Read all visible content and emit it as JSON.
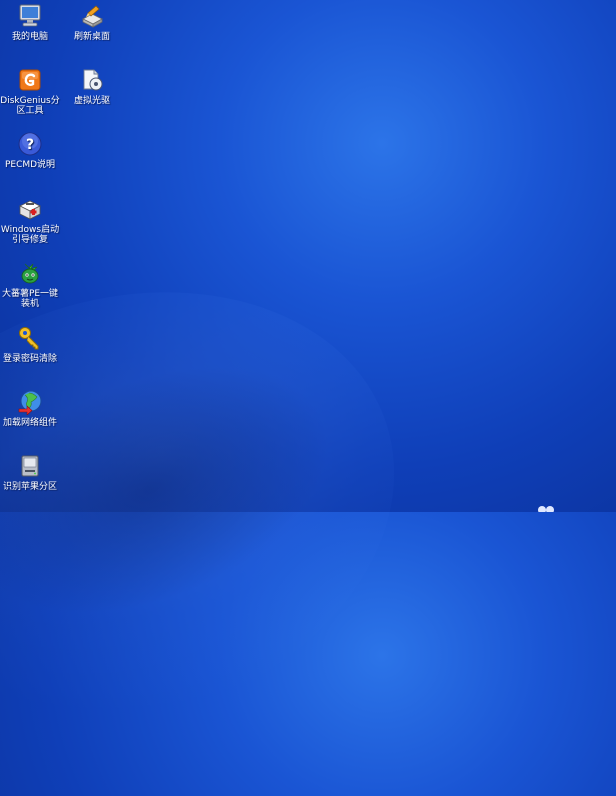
{
  "desktop": {
    "icons": [
      {
        "label": "我的电脑",
        "icon": "my-computer-icon"
      },
      {
        "label": "刷新桌面",
        "icon": "refresh-desktop-icon"
      },
      {
        "label": "DiskGenius分区工具",
        "icon": "diskgenius-icon"
      },
      {
        "label": "虚拟光驱",
        "icon": "virtual-drive-icon"
      },
      {
        "label": "PECMD说明",
        "icon": "help-icon"
      },
      {
        "label": "Windows启动引导修复",
        "icon": "boot-repair-icon"
      },
      {
        "label": "大蕃薯PE一键装机",
        "icon": "installer-icon"
      },
      {
        "label": "登录密码清除",
        "icon": "key-icon"
      },
      {
        "label": "加载网络组件",
        "icon": "network-globe-icon"
      },
      {
        "label": "识别苹果分区",
        "icon": "disk-drive-icon"
      }
    ]
  },
  "colors": {
    "background": "#1a55d4",
    "background_dark": "#0a2f95",
    "label_text": "#ffffff"
  }
}
